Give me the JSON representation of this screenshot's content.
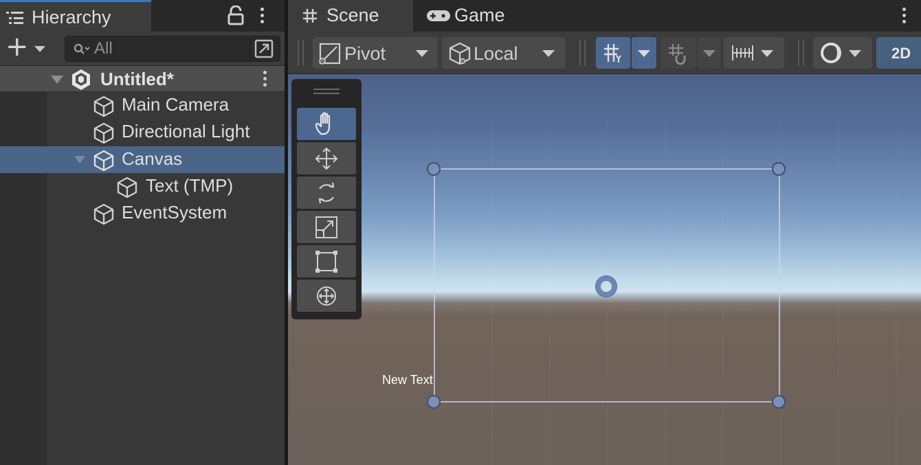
{
  "hierarchy": {
    "tab_label": "Hierarchy",
    "search_placeholder": "All",
    "scene_name": "Untitled*",
    "items": [
      {
        "label": "Main Camera",
        "depth": 1,
        "selected": false
      },
      {
        "label": "Directional Light",
        "depth": 1,
        "selected": false
      },
      {
        "label": "Canvas",
        "depth": 1,
        "selected": true,
        "expanded": true
      },
      {
        "label": "Text (TMP)",
        "depth": 2,
        "selected": false
      },
      {
        "label": "EventSystem",
        "depth": 1,
        "selected": false
      }
    ]
  },
  "scene_window": {
    "tabs": [
      {
        "label": "Scene",
        "icon": "hash-icon",
        "active": true
      },
      {
        "label": "Game",
        "icon": "gamepad-icon",
        "active": false
      }
    ],
    "toolbar": {
      "pivot_label": "Pivot",
      "space_label": "Local",
      "mode_2d_label": "2D"
    },
    "tools": [
      {
        "name": "hand-tool",
        "icon": "hand-icon",
        "active": true
      },
      {
        "name": "move-tool",
        "icon": "move-arrows-icon",
        "active": false
      },
      {
        "name": "rotate-tool",
        "icon": "rotate-icon",
        "active": false
      },
      {
        "name": "scale-tool",
        "icon": "scale-icon",
        "active": false
      },
      {
        "name": "rect-tool",
        "icon": "rect-transform-icon",
        "active": false
      },
      {
        "name": "transform-tool",
        "icon": "transform-icon",
        "active": false
      }
    ],
    "viewport": {
      "object_text": "New Text"
    }
  },
  "colors": {
    "selection": "#4a6588",
    "active_tool": "#4d6890",
    "accent_2d": "#46607f",
    "sky_top": "#4c6189",
    "horizon": "#cfe3ef",
    "ground": "#6e625a"
  }
}
